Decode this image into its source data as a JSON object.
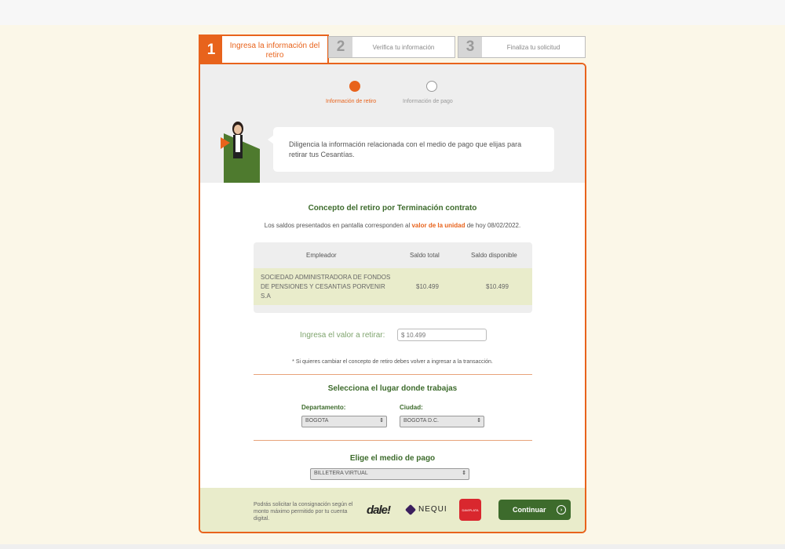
{
  "steps": [
    {
      "number": "1",
      "label": "Ingresa la información del retiro"
    },
    {
      "number": "2",
      "label": "Verifica tu información"
    },
    {
      "number": "3",
      "label": "Finaliza tu solicitud"
    }
  ],
  "substeps": {
    "active": "Información de retiro",
    "inactive": "Información de pago"
  },
  "bubble_text": "Diligencia la información relacionada con el medio de pago que elijas para retirar tus Cesantías.",
  "concept_title": "Concepto del retiro por Terminación contrato",
  "saldo_note": {
    "prefix": "Los saldos presentados en pantalla corresponden al",
    "link": "valor de la unidad",
    "suffix": "de hoy 08/02/2022."
  },
  "table": {
    "headers": [
      "Empleador",
      "Saldo total",
      "Saldo disponible"
    ],
    "row": {
      "employer": "SOCIEDAD ADMINISTRADORA DE FONDOS DE PENSIONES Y CESANTIAS PORVENIR S.A",
      "total": "$10.499",
      "available": "$10.499"
    }
  },
  "amount": {
    "label": "Ingresa el valor a retirar:",
    "placeholder": "$ 10.499"
  },
  "change_note": "* Si quieres cambiar el concepto de retiro debes volver a ingresar a la transacción.",
  "workplace": {
    "title": "Selecciona el lugar donde trabajas",
    "department_label": "Departamento:",
    "department_value": "BOGOTA",
    "city_label": "Ciudad:",
    "city_value": "BOGOTA D.C."
  },
  "payment": {
    "title": "Elige el medio de pago",
    "value": "BILLETERA VIRTUAL"
  },
  "footer": {
    "note": "Podrás solicitar la consignación según el monto máximo permitido por tu cuenta digital.",
    "logo_dale": "dale!",
    "logo_nequi": "NEQUI",
    "logo_red": "DAVIPLATA",
    "continue_label": "Continuar"
  },
  "colors": {
    "accent": "#e8631c",
    "green": "#3d6b2c",
    "highlight_row": "#e9eccb"
  }
}
